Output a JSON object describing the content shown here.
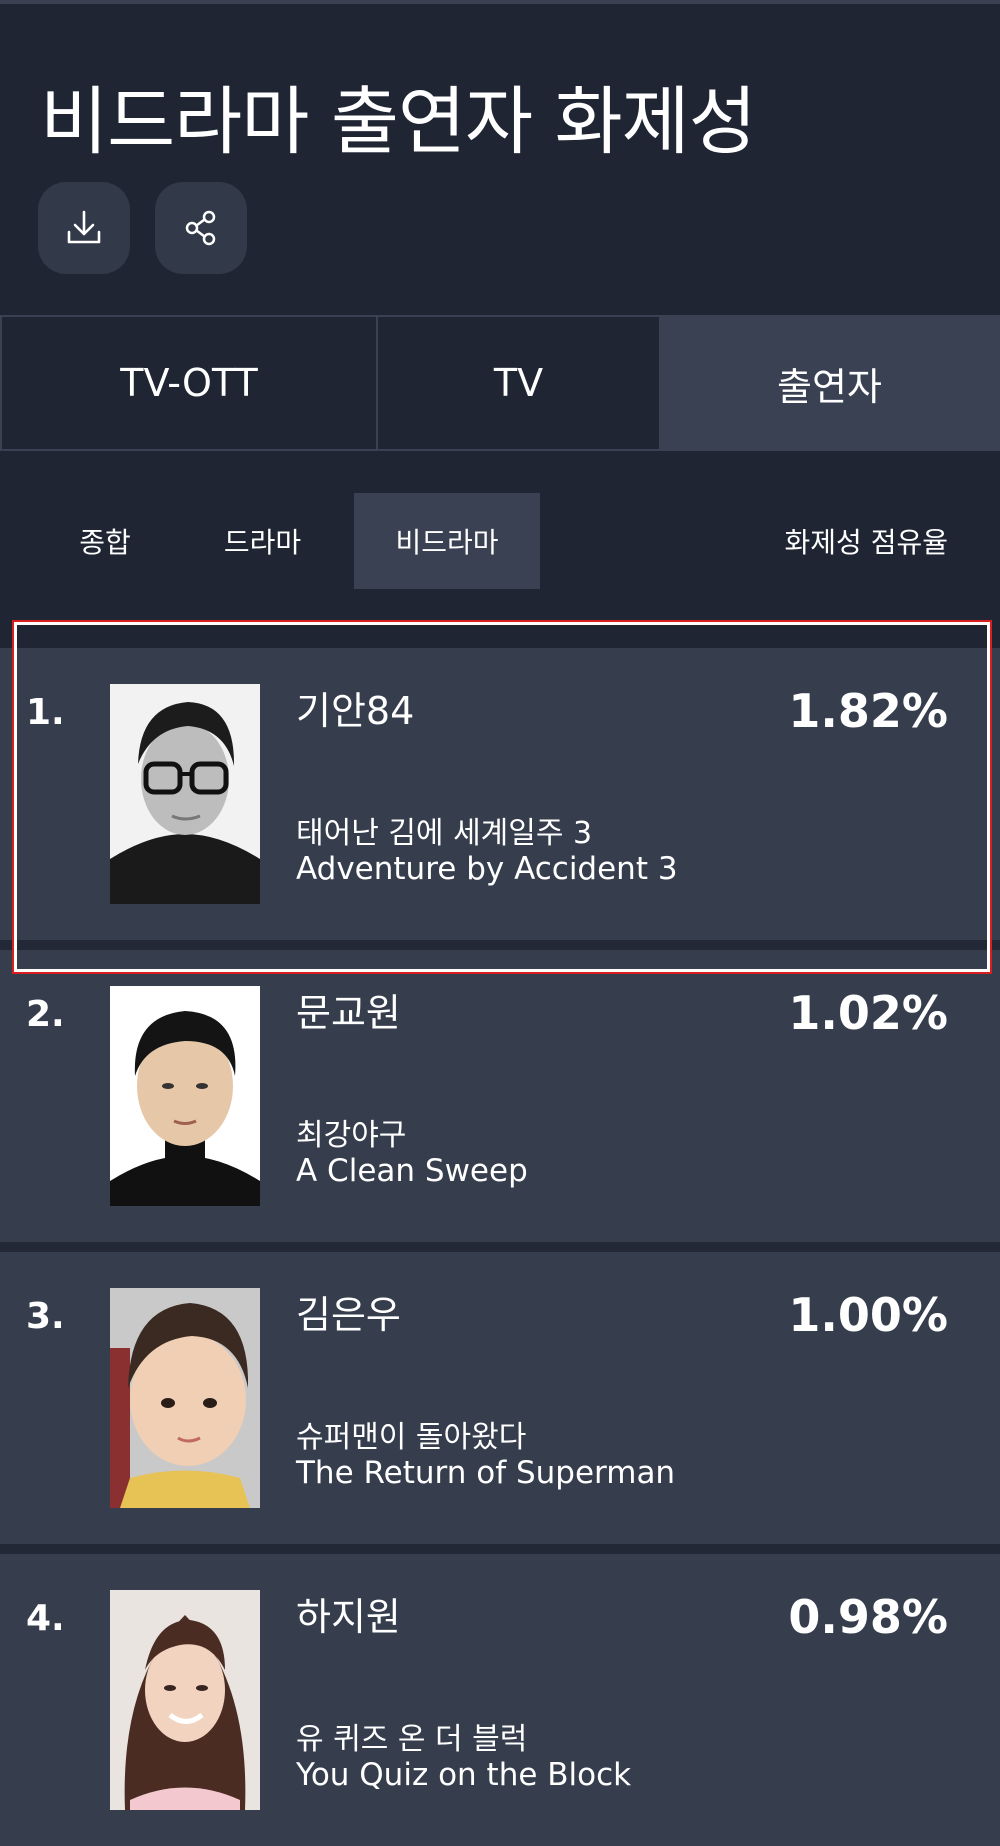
{
  "header": {
    "title": "비드라마 출연자 화제성",
    "download_icon": "download-icon",
    "share_icon": "share-icon"
  },
  "tabs": [
    {
      "label": "TV-OTT",
      "active": false
    },
    {
      "label": "TV",
      "active": false
    },
    {
      "label": "출연자",
      "active": true
    }
  ],
  "subtabs": [
    {
      "label": "종합",
      "active": false
    },
    {
      "label": "드라마",
      "active": false
    },
    {
      "label": "비드라마",
      "active": true
    }
  ],
  "share_label": "화제성 점유율",
  "rankings": [
    {
      "rank": "1.",
      "name": "기안84",
      "share": "1.82%",
      "program_ko": "태어난 김에 세계일주 3",
      "program_en": "Adventure by Accident 3"
    },
    {
      "rank": "2.",
      "name": "문교원",
      "share": "1.02%",
      "program_ko": "최강야구",
      "program_en": "A Clean Sweep"
    },
    {
      "rank": "3.",
      "name": "김은우",
      "share": "1.00%",
      "program_ko": "슈퍼맨이 돌아왔다",
      "program_en": "The Return of Superman"
    },
    {
      "rank": "4.",
      "name": "하지원",
      "share": "0.98%",
      "program_ko": "유 퀴즈 온 더 블럭",
      "program_en": "You Quiz on the Block"
    }
  ],
  "colors": {
    "background": "#1f2533",
    "row": "#363d4d",
    "highlight": "#d81e1e"
  }
}
